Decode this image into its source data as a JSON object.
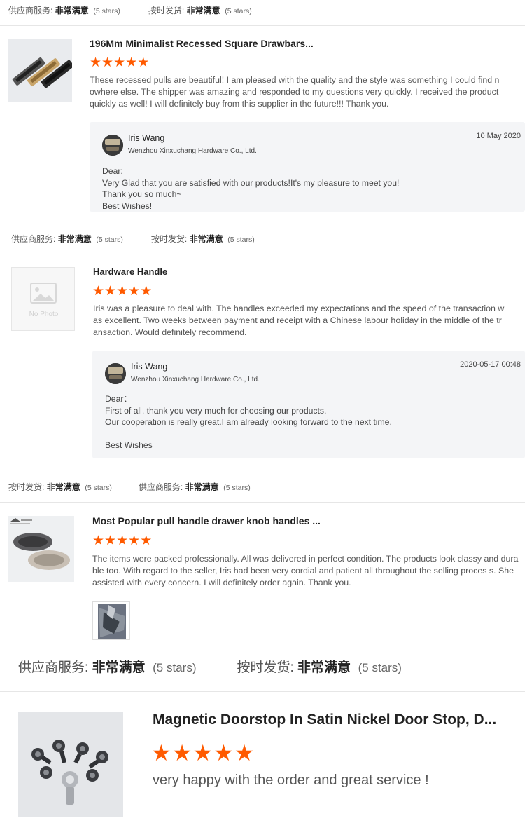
{
  "rating_rows": [
    {
      "first_label": "供应商服务:",
      "first_value": "非常满意",
      "first_stars": "(5 stars)",
      "second_label": "按时发货:",
      "second_value": "非常满意",
      "second_stars": "(5 stars)"
    },
    {
      "first_label": "供应商服务:",
      "first_value": "非常满意",
      "first_stars": "(5 stars)",
      "second_label": "按时发货:",
      "second_value": "非常满意",
      "second_stars": "(5 stars)"
    },
    {
      "first_label": "按时发货:",
      "first_value": "非常满意",
      "first_stars": "(5 stars)",
      "second_label": "供应商服务:",
      "second_value": "非常满意",
      "second_stars": "(5 stars)"
    },
    {
      "first_label": "供应商服务:",
      "first_value": "非常满意",
      "first_stars": "(5 stars)",
      "second_label": "按时发货:",
      "second_value": "非常满意",
      "second_stars": "(5 stars)"
    }
  ],
  "reviews": [
    {
      "title": "196Mm Minimalist Recessed Square Drawbars...",
      "rating": 5,
      "text": "These recessed pulls are beautiful! I am pleased with the quality and the style was something I could find n owhere else. The shipper was amazing and responded to my questions very quickly. I received the product quickly as well! I will definitely buy from this supplier in the future!!! Thank you.",
      "reply": {
        "name": "Iris Wang",
        "company": "Wenzhou Xinxuchang Hardware Co., Ltd.",
        "date": "10 May 2020",
        "lines": [
          "Dear:",
          "Very Glad that you are satisfied with our products!It's my pleasure to meet you!",
          "Thank you so much~",
          "Best Wishes!"
        ]
      }
    },
    {
      "title": "Hardware Handle",
      "no_photo": "No Photo",
      "rating": 5,
      "text": "Iris was a pleasure to deal with. The handles exceeded my expectations and the speed of the transaction w as excellent. Two weeks between payment and receipt with a Chinese labour holiday in the middle of the tr ansaction. Would definitely recommend.",
      "reply": {
        "name": "Iris Wang",
        "company": "Wenzhou Xinxuchang Hardware Co., Ltd.",
        "date": "2020-05-17 00:48",
        "lines": [
          "Dear：",
          "First of all, thank you very much for choosing our products.",
          "Our cooperation is really great.I am already looking forward to the next time.",
          "",
          "Best Wishes"
        ]
      }
    },
    {
      "title": "Most Popular pull handle drawer knob handles ...",
      "rating": 5,
      "text": "The items were packed professionally. All was delivered in perfect condition. The products look classy and durable too. With regard to the seller, Iris had been very cordial and patient all throughout the selling proces s. She assisted with every concern. I will definitely order again. Thank you."
    },
    {
      "title": "Magnetic Doorstop In Satin Nickel Door Stop, D...",
      "rating": 5,
      "text": "very happy with the order and great service !"
    }
  ],
  "colors": {
    "star": "#ff5a00",
    "reply_bg": "#f4f5f7",
    "divider": "#e6e6e6"
  },
  "icons": {
    "star": "star-icon",
    "no_photo": "image-placeholder-icon"
  }
}
